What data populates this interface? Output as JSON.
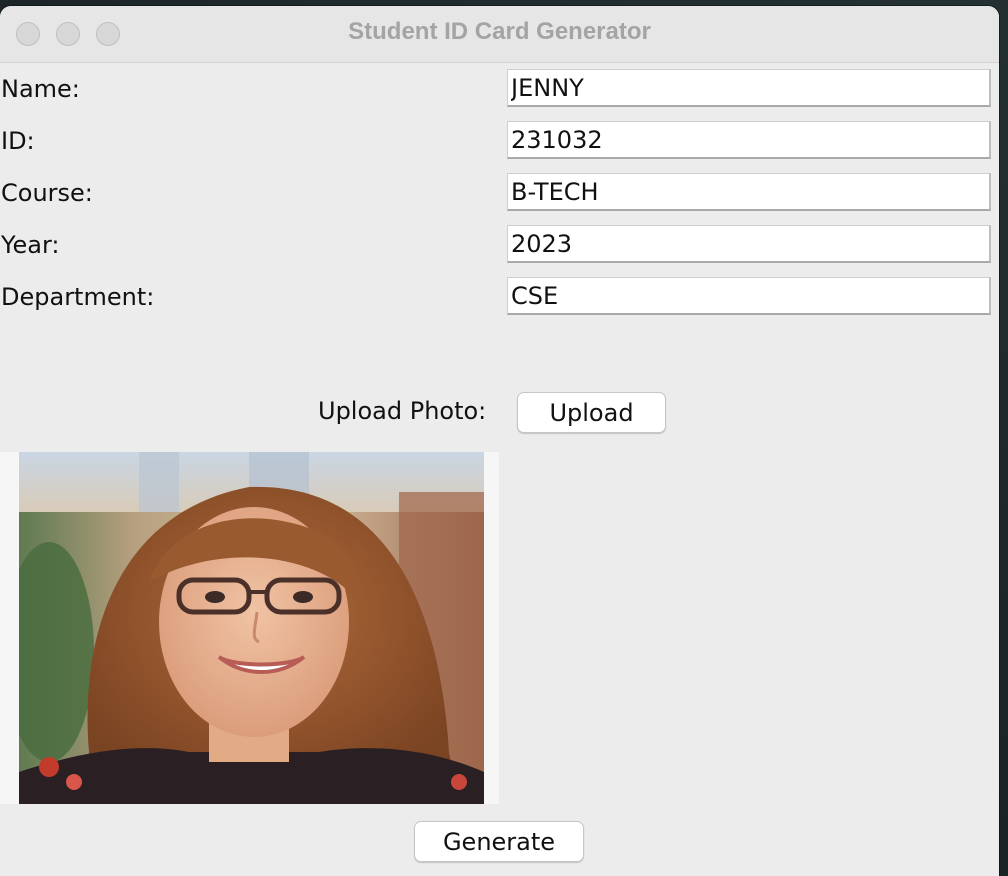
{
  "window": {
    "title": "Student ID Card Generator"
  },
  "form": {
    "fields": [
      {
        "label": "Name:",
        "value": "JENNY"
      },
      {
        "label": "ID:",
        "value": "231032"
      },
      {
        "label": "Course:",
        "value": "B-TECH"
      },
      {
        "label": "Year:",
        "value": "2023"
      },
      {
        "label": "Department:",
        "value": "CSE"
      }
    ]
  },
  "upload": {
    "label": "Upload Photo:",
    "button_label": "Upload"
  },
  "photo": {
    "description_icon": "student-photo"
  },
  "actions": {
    "generate_label": "Generate"
  },
  "colors": {
    "window_bg": "#ececec",
    "title_text": "#a4a4a4",
    "input_bg": "#ffffff"
  }
}
